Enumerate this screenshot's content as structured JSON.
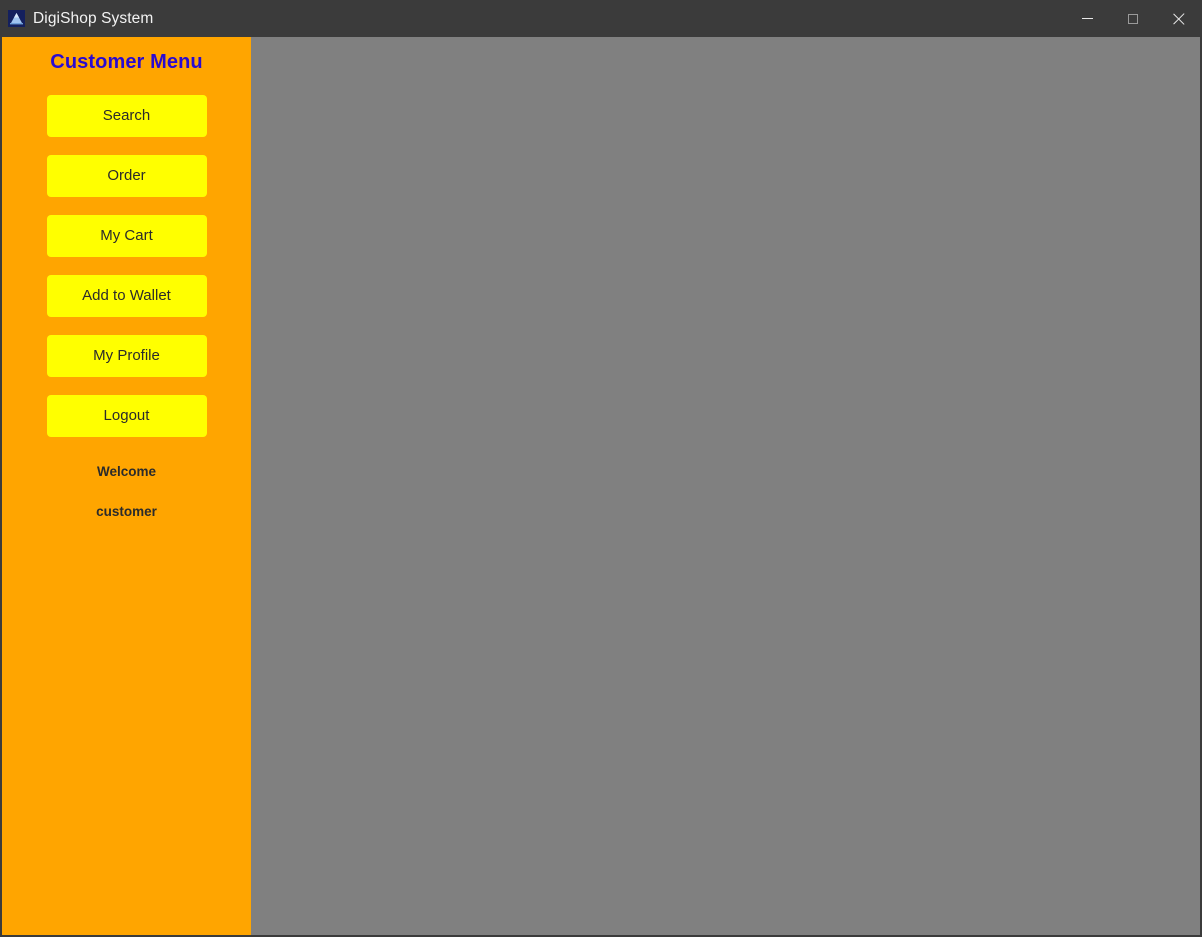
{
  "window": {
    "title": "DigiShop System",
    "icon": "app-mountain-icon",
    "controls": {
      "minimize": "minimize-icon",
      "maximize": "maximize-icon",
      "close": "close-icon"
    },
    "titlebar_color": "#3b3b3b",
    "content_color": "#808080"
  },
  "sidebar": {
    "heading": "Customer Menu",
    "heading_color": "#2a0ad0",
    "background_color": "#ffa500",
    "button_color": "#ffff00",
    "buttons": [
      {
        "label": "Search"
      },
      {
        "label": "Order"
      },
      {
        "label": "My Cart"
      },
      {
        "label": "Add to Wallet"
      },
      {
        "label": "My Profile"
      },
      {
        "label": "Logout"
      }
    ],
    "welcome": {
      "greeting": "Welcome",
      "username": "customer"
    }
  },
  "main": {
    "content": ""
  }
}
